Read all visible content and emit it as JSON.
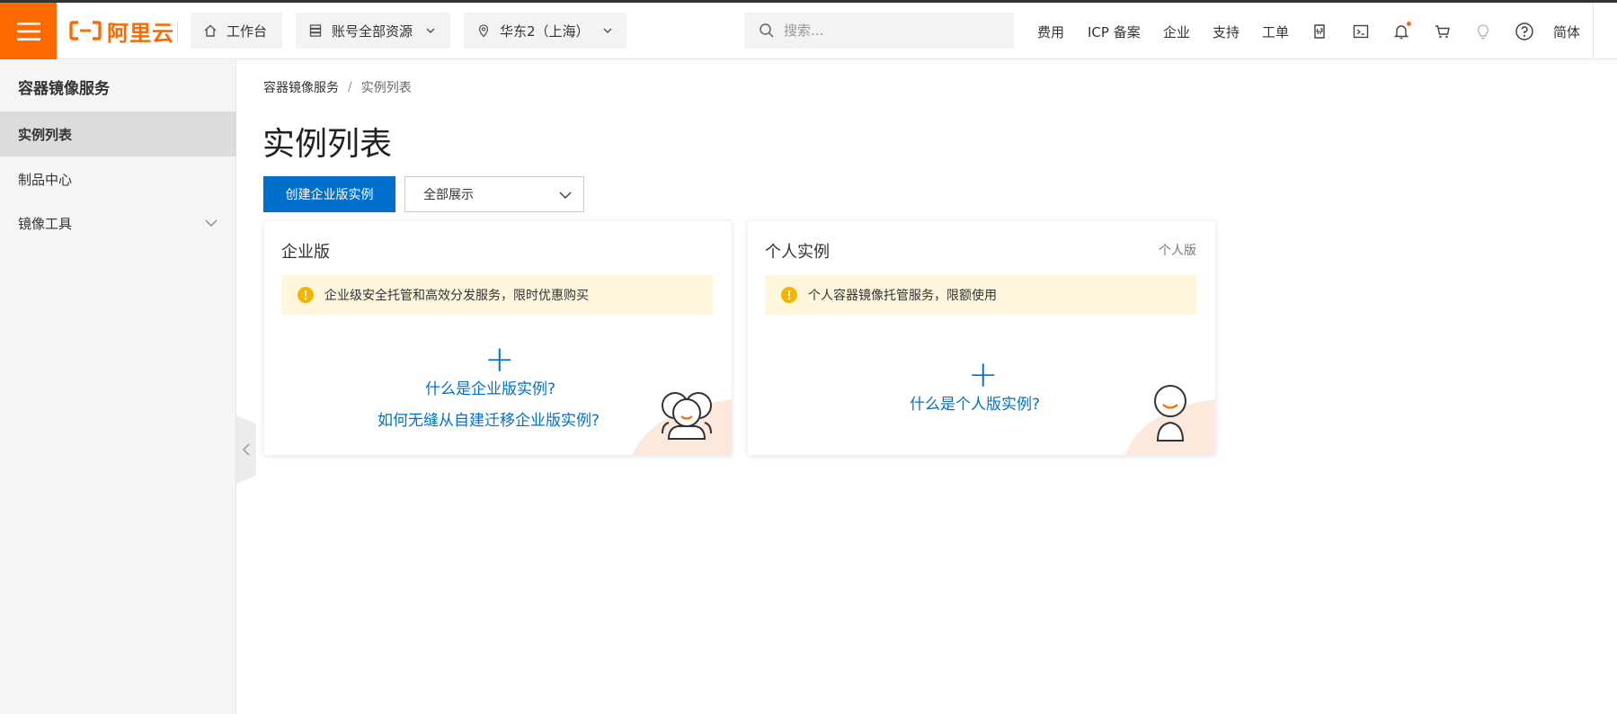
{
  "header": {
    "logo_text": "阿里云",
    "workbench": "工作台",
    "resources": "账号全部资源",
    "region": "华东2（上海）",
    "search_placeholder": "搜索...",
    "links": {
      "billing": "费用",
      "icp": "ICP 备案",
      "enterprise": "企业",
      "support": "支持",
      "ticket": "工单",
      "lang": "简体"
    },
    "icons": [
      "api-icon",
      "terminal-icon",
      "bell-icon",
      "cart-icon",
      "bulb-icon",
      "help-icon"
    ],
    "accent_color": "#ff6a00"
  },
  "sidebar": {
    "title": "容器镜像服务",
    "items": [
      {
        "label": "实例列表",
        "active": true
      },
      {
        "label": "制品中心",
        "active": false
      },
      {
        "label": "镜像工具",
        "active": false,
        "expandable": true
      }
    ]
  },
  "main": {
    "breadcrumb": [
      "容器镜像服务",
      "实例列表"
    ],
    "title": "实例列表",
    "create_button": "创建企业版实例",
    "filter_select": "全部展示",
    "primary_color": "#0070cc"
  },
  "cards": {
    "enterprise": {
      "title": "企业版",
      "notice": "企业级安全托管和高效分发服务，限时优惠购买",
      "link_what": "什么是企业版实例?",
      "link_migrate": "如何无缝从自建迁移企业版实例?"
    },
    "personal": {
      "title": "个人实例",
      "tag": "个人版",
      "notice": "个人容器镜像托管服务，限额使用",
      "link_what": "什么是个人版实例?"
    }
  }
}
